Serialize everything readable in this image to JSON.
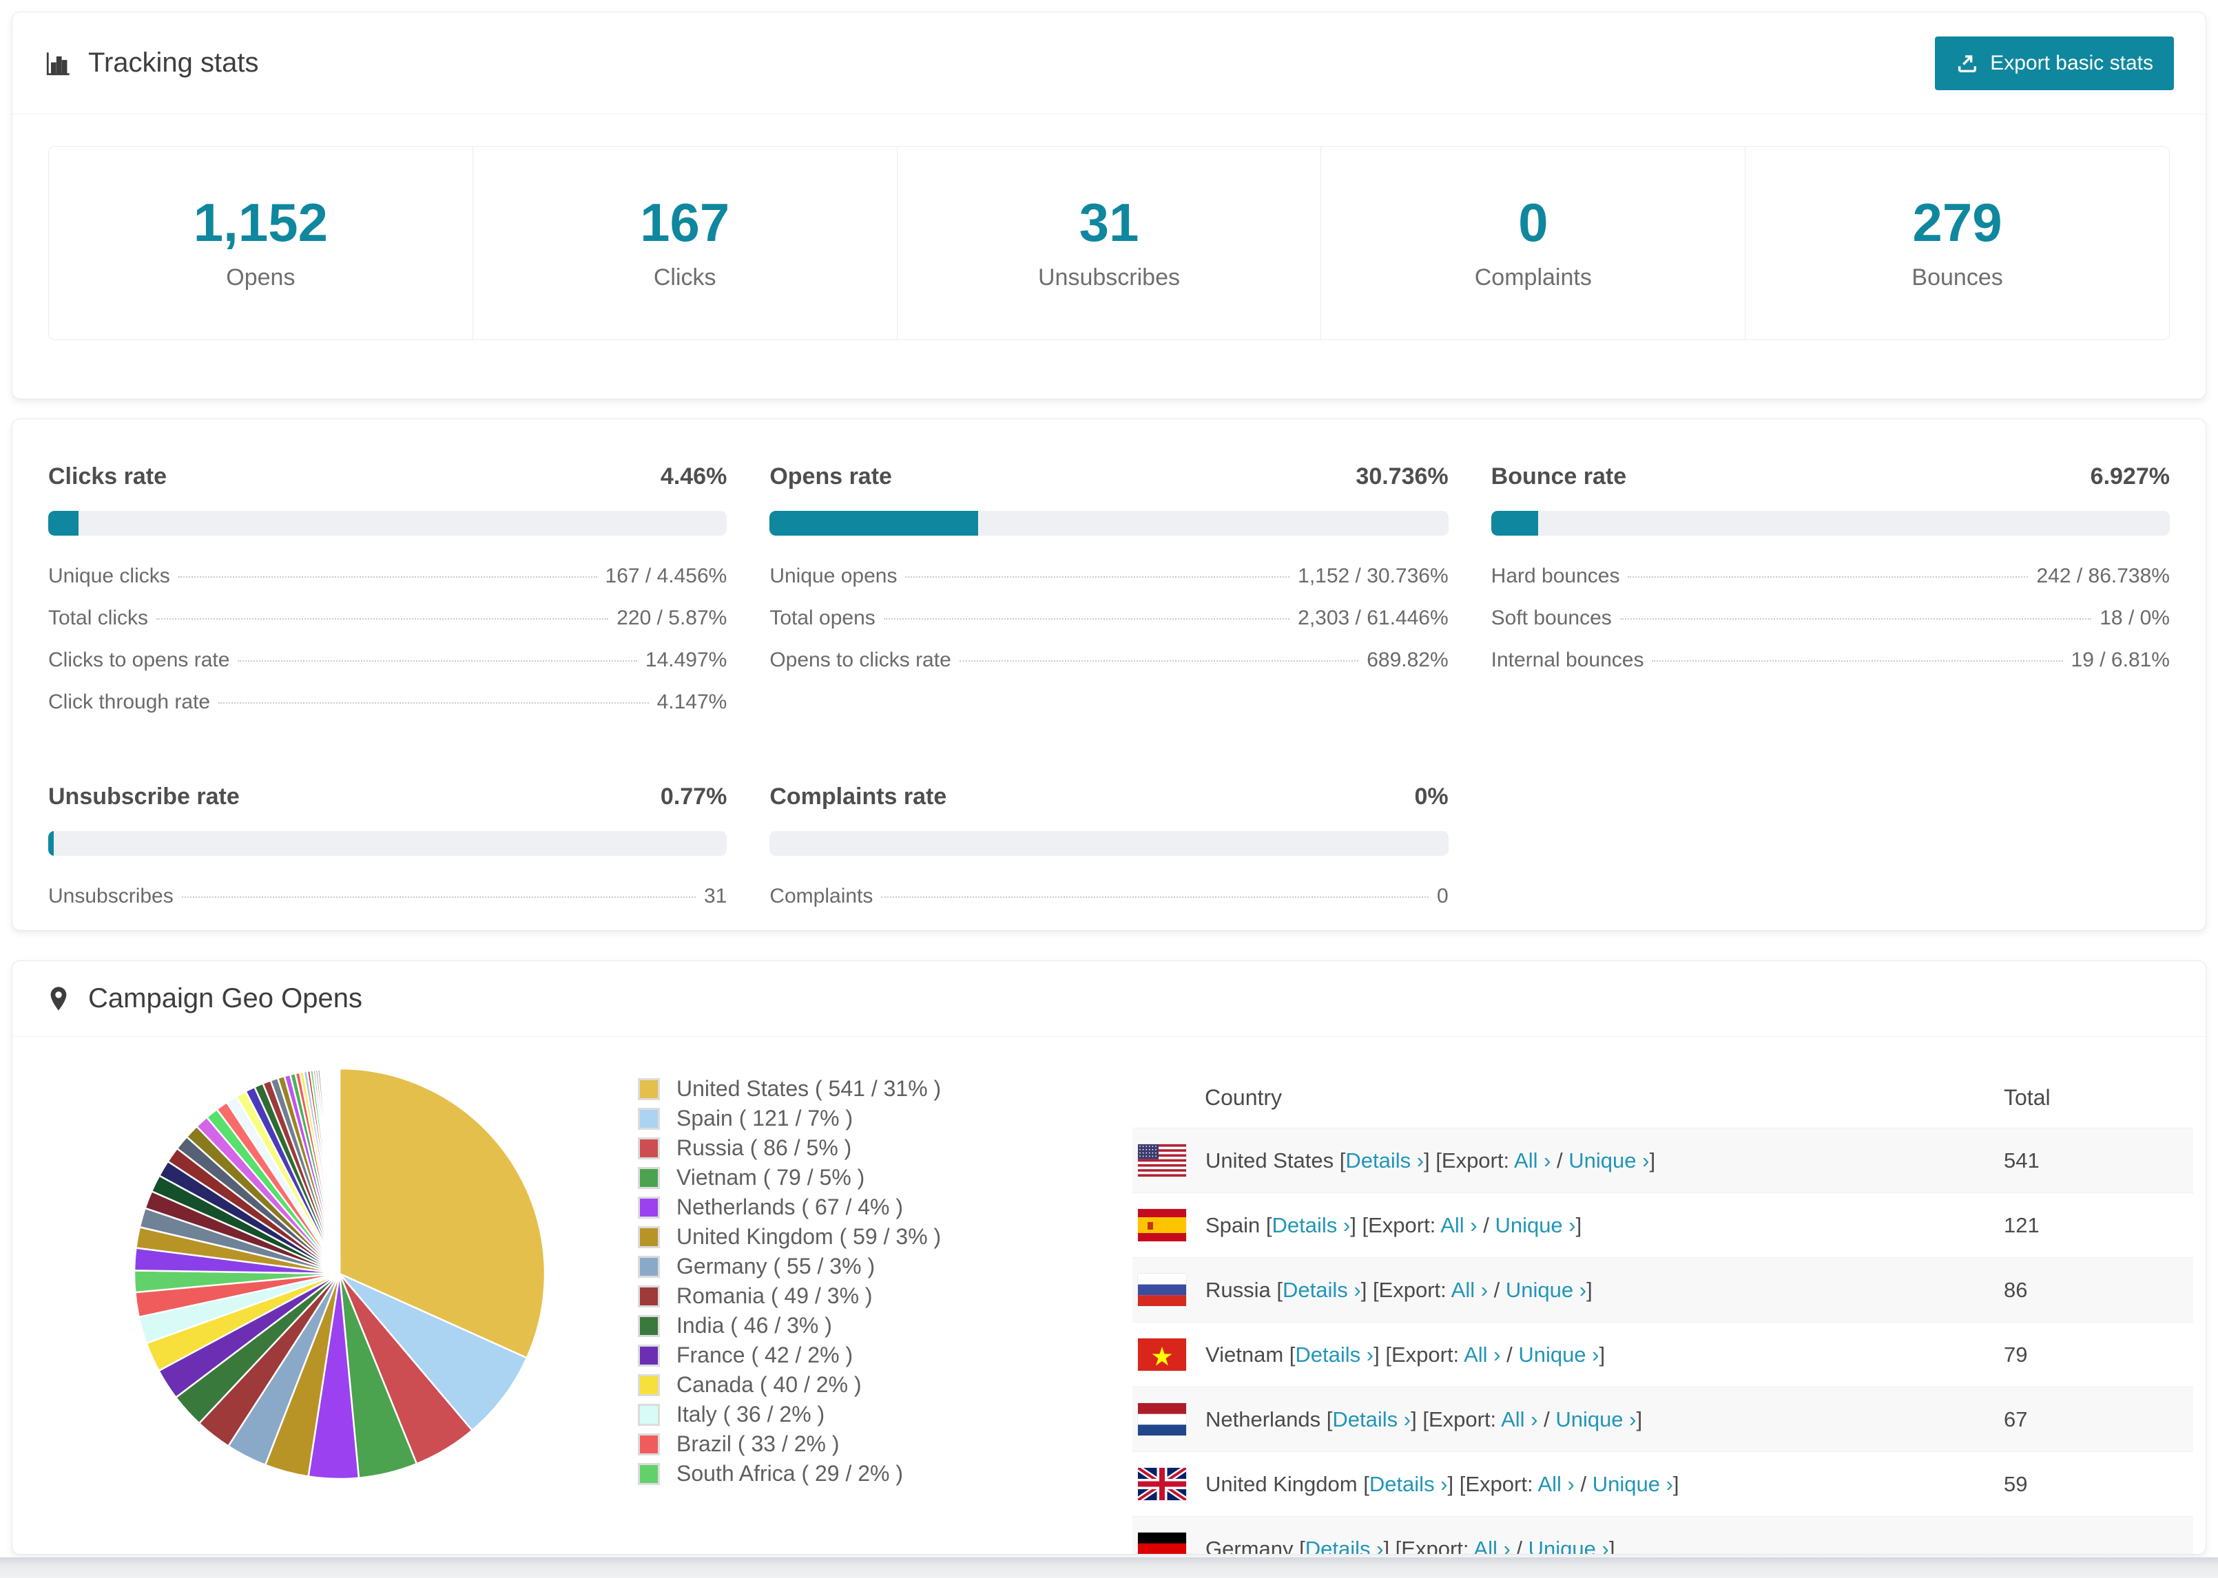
{
  "accent": {
    "teal": "#0f879e",
    "link": "#2195b7",
    "bar_bg": "#eef0f3"
  },
  "header": {
    "title": "Tracking stats",
    "icon": "bar-chart-icon",
    "export_button": {
      "label": "Export basic stats",
      "icon": "export-icon"
    }
  },
  "summary_stats": [
    {
      "value": "1,152",
      "label": "Opens"
    },
    {
      "value": "167",
      "label": "Clicks"
    },
    {
      "value": "31",
      "label": "Unsubscribes"
    },
    {
      "value": "0",
      "label": "Complaints"
    },
    {
      "value": "279",
      "label": "Bounces"
    }
  ],
  "rate_panels": [
    {
      "title": "Clicks rate",
      "value": "4.46%",
      "bar_pct": 4.46,
      "rows": [
        {
          "label": "Unique clicks",
          "value": "167 / 4.456%"
        },
        {
          "label": "Total clicks",
          "value": "220 / 5.87%"
        },
        {
          "label": "Clicks to opens rate",
          "value": "14.497%"
        },
        {
          "label": "Click through rate",
          "value": "4.147%"
        }
      ]
    },
    {
      "title": "Opens rate",
      "value": "30.736%",
      "bar_pct": 30.736,
      "rows": [
        {
          "label": "Unique opens",
          "value": "1,152 / 30.736%"
        },
        {
          "label": "Total opens",
          "value": "2,303 / 61.446%"
        },
        {
          "label": "Opens to clicks rate",
          "value": "689.82%"
        }
      ]
    },
    {
      "title": "Bounce rate",
      "value": "6.927%",
      "bar_pct": 6.927,
      "rows": [
        {
          "label": "Hard bounces",
          "value": "242 / 86.738%"
        },
        {
          "label": "Soft bounces",
          "value": "18 / 0%"
        },
        {
          "label": "Internal bounces",
          "value": "19 / 6.81%"
        }
      ]
    },
    {
      "title": "Unsubscribe rate",
      "value": "0.77%",
      "bar_pct": 0.77,
      "rows": [
        {
          "label": "Unsubscribes",
          "value": "31"
        }
      ]
    },
    {
      "title": "Complaints rate",
      "value": "0%",
      "bar_pct": 0,
      "rows": [
        {
          "label": "Complaints",
          "value": "0"
        }
      ]
    }
  ],
  "geo": {
    "title": "Campaign Geo Opens",
    "icon": "map-pin-icon",
    "table": {
      "columns": [
        "Country",
        "Total"
      ],
      "glue": {
        "bracket_open": "[",
        "bracket_close": "]",
        "export_prefix": "[Export:",
        "slash": "/",
        "chevron": "›",
        "colon_space": " "
      },
      "links": {
        "details": "Details",
        "all": "All",
        "unique": "Unique"
      },
      "rows": [
        {
          "country": "United States",
          "total": "541",
          "flag": "us-flag"
        },
        {
          "country": "Spain",
          "total": "121",
          "flag": "es-flag"
        },
        {
          "country": "Russia",
          "total": "86",
          "flag": "ru-flag"
        },
        {
          "country": "Vietnam",
          "total": "79",
          "flag": "vn-flag"
        },
        {
          "country": "Netherlands",
          "total": "67",
          "flag": "nl-flag"
        },
        {
          "country": "United Kingdom",
          "total": "59",
          "flag": "gb-flag"
        },
        {
          "country": "Germany",
          "total": "",
          "flag": "de-flag"
        }
      ]
    }
  },
  "chart_data": {
    "type": "pie",
    "title": "Campaign Geo Opens",
    "legend_position": "right",
    "start_angle_deg": 0,
    "direction": "clockwise",
    "slice_gap_color": "#ffffff",
    "categories": [
      "United States",
      "Spain",
      "Russia",
      "Vietnam",
      "Netherlands",
      "United Kingdom",
      "Germany",
      "Romania",
      "India",
      "France",
      "Canada",
      "Italy",
      "Brazil",
      "South Africa"
    ],
    "values": [
      541,
      121,
      86,
      79,
      67,
      59,
      55,
      49,
      46,
      42,
      40,
      36,
      33,
      29
    ],
    "pcts": [
      "31",
      "7",
      "5",
      "5",
      "4",
      "3",
      "3",
      "3",
      "3",
      "2",
      "2",
      "2",
      "2",
      "2"
    ],
    "colors": [
      "#e5bf4b",
      "#abd3f2",
      "#cc4e52",
      "#4ba34f",
      "#9b41f0",
      "#b89427",
      "#8aa9c8",
      "#9e3a3a",
      "#397a3c",
      "#6c2fb4",
      "#f7e03c",
      "#d8fbf7",
      "#f05c5c",
      "#63d169"
    ],
    "others": {
      "values": [
        30,
        28,
        26,
        24,
        23,
        22,
        21,
        20,
        19,
        18,
        17,
        16,
        15,
        14,
        13,
        12,
        11,
        10,
        9,
        8,
        7,
        6,
        5,
        5,
        4,
        4,
        3,
        3,
        3,
        2,
        2,
        2,
        2,
        2,
        1,
        1,
        1,
        1,
        1,
        1,
        1,
        1,
        1,
        1,
        1,
        1,
        1,
        1,
        1,
        1
      ],
      "colors": [
        "#8b3fe8",
        "#b89427",
        "#6f8296",
        "#7a2430",
        "#14502a",
        "#262668",
        "#8f2d2d",
        "#566176",
        "#8a7a1e",
        "#d565e8",
        "#57e06b",
        "#fb6b6b",
        "#eef9ff",
        "#f8ff80",
        "#4b3bba",
        "#2f6b33",
        "#9e3a3a",
        "#6f7f92",
        "#9a8422",
        "#c453f0",
        "#46b457",
        "#f05c5c",
        "#fce94f",
        "#a5c8e8",
        "#d92b2b",
        "#57e06b",
        "#e24fe2",
        "#8a7a1e",
        "#5d7a8c",
        "#2a2a6e",
        "#7a2430",
        "#14502a",
        "#3a3a8c",
        "#c9a227",
        "#d565e8",
        "#9ad1f5",
        "#e8c34d",
        "#b8a0f0",
        "#f5f5f5",
        "#cfe8cf",
        "#f0c0c0",
        "#d0d0f8",
        "#efe08a",
        "#c8f0e8",
        "#e8d0f5",
        "#f5e8d0",
        "#d8e8f5",
        "#f0d8d8",
        "#e0f0d0",
        "#f8f0e0"
      ]
    }
  }
}
